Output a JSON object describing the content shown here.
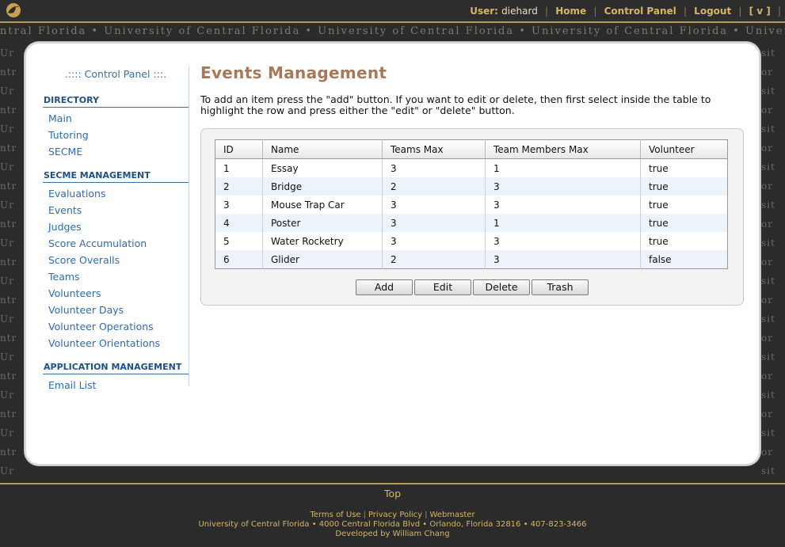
{
  "topbar": {
    "user_label": "User:",
    "user_name": "diehard",
    "home": "Home",
    "control_panel": "Control Panel",
    "logout": "Logout",
    "v_link": "[ v ]"
  },
  "ticker": "ntral Florida • University of Central Florida • University of Central Florida • University of Central Florida • University of Central Flori",
  "side_left": [
    "Ur",
    "ntr",
    "Ur",
    "ntr",
    "Ur",
    "ntr",
    "Ur",
    "ntr",
    "Ur",
    "ntr",
    "Ur",
    "ntr",
    "Ur",
    "ntr",
    "Ur",
    "ntr",
    "Ur",
    "ntr",
    "Ur",
    "ntr",
    "Ur",
    "ntr",
    "Ur"
  ],
  "side_right": [
    "sit",
    "or",
    "sit",
    "or",
    "sit",
    "or",
    "sit",
    "or",
    "sit",
    "or",
    "sit",
    "or",
    "sit",
    "or",
    "sit",
    "or",
    "sit",
    "or",
    "sit",
    "or",
    "sit",
    "or",
    "sit"
  ],
  "sidebar": {
    "title": ".:::: Control Panel :::.",
    "sections": [
      {
        "heading": "DIRECTORY",
        "items": [
          "Main",
          "Tutoring",
          "SECME"
        ]
      },
      {
        "heading": "SECME MANAGEMENT",
        "items": [
          "Evaluations",
          "Events",
          "Judges",
          "Score Accumulation",
          "Score Overalls",
          "Teams",
          "Volunteers",
          "Volunteer Days",
          "Volunteer Operations",
          "Volunteer Orientations"
        ]
      },
      {
        "heading": "APPLICATION MANAGEMENT",
        "items": [
          "Email List"
        ]
      }
    ]
  },
  "main": {
    "title": "Events Management",
    "intro": "To add an item press the \"add\" button. If you want to edit or delete, then first select inside the table to highlight the row and press either the \"edit\" or \"delete\" button."
  },
  "grid": {
    "columns": [
      "ID",
      "Name",
      "Teams Max",
      "Team Members Max",
      "Volunteer"
    ],
    "rows": [
      [
        "1",
        "Essay",
        "3",
        "1",
        "true"
      ],
      [
        "2",
        "Bridge",
        "2",
        "3",
        "true"
      ],
      [
        "3",
        "Mouse Trap Car",
        "3",
        "3",
        "true"
      ],
      [
        "4",
        "Poster",
        "3",
        "1",
        "true"
      ],
      [
        "5",
        "Water Rocketry",
        "3",
        "3",
        "true"
      ],
      [
        "6",
        "Glider",
        "2",
        "3",
        "false"
      ]
    ]
  },
  "buttons": {
    "add": "Add",
    "edit": "Edit",
    "delete": "Delete",
    "trash": "Trash"
  },
  "footer": {
    "top_link": "Top",
    "terms": "Terms of Use",
    "privacy": "Privacy Policy",
    "webmaster": "Webmaster",
    "address": "University of Central Florida • 4000 Central Florida Blvd • Orlando, Florida 32816 • 407-823-3466",
    "developer": "Developed by William Chang"
  },
  "colors": {
    "gold": "#d6b46a",
    "dark": "#2b2b2b",
    "link_blue": "#2f6bb0",
    "title_brown": "#a7785a"
  }
}
